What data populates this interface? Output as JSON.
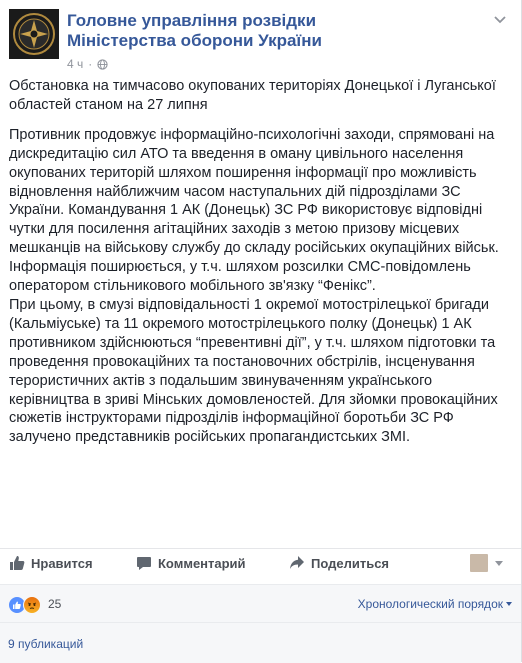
{
  "page": {
    "name": "Головне управління розвідки Міністерства оборони України",
    "time": "4 ч",
    "colors": {
      "link": "#365899",
      "meta": "#90949c",
      "text": "#1d2129",
      "panel": "#f6f7f9"
    },
    "icons": {
      "privacy": "globe-icon",
      "menu": "chevron-down-icon"
    }
  },
  "post": {
    "headline": "Обстановка на тимчасово окупованих територіях Донецької і Луганської областей станом на 27 липня",
    "paragraph1": "Противник продовжує інформаційно-психологічні заходи, спрямовані на дискредитацію сил АТО та введення в оману цивільного населення окупованих територій шляхом поширення інформації про можливість відновлення найближчим часом наступальних дій підрозділами ЗС України. Командування 1 АК (Донецьк) ЗС РФ використовує відповідні чутки для посилення агітаційних заходів з метою призову місцевих мешканців на військову службу до складу російських окупаційних військ. Інформація поширюється, у т.ч. шляхом розсилки СМС-повідомлень оператором стільникового мобільного зв'язку “Фенікс”.",
    "paragraph2": "При цьому, в смузі відповідальності 1 окремої мотострілецької бригади (Кальміуське) та 11 окремого мотострілецького полку (Донецьк) 1 АК противником здійснюються “превентивні дії”, у т.ч. шляхом підготовки та проведення провокаційних та постановочних обстрілів, інсценування терористичних актів з подальшим звинуваченням українського керівництва в зриві Мінських домовленостей. Для зйомки провокаційних сюжетів інструкторами підрозділів інформаційної боротьби ЗС РФ залучено представників російських пропагандистських ЗМІ."
  },
  "actions": {
    "like": "Нравится",
    "comment": "Комментарий",
    "share": "Поделиться",
    "icons": [
      "like-icon",
      "comment-icon",
      "share-icon"
    ]
  },
  "reactions": {
    "count": "25",
    "types": [
      "like",
      "angry"
    ],
    "sort_label": "Хронологический порядок"
  },
  "shares": {
    "label": "9 публикаций"
  }
}
